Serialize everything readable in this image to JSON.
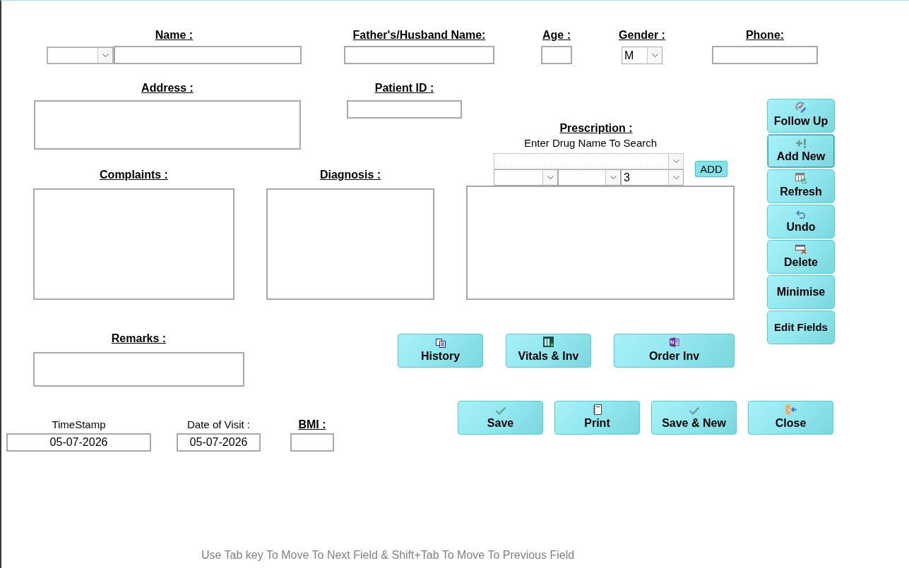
{
  "header_fields": [
    {
      "kind": "titled",
      "label": "Name :"
    },
    {
      "kind": "text",
      "label": "Father's/Husband Name:"
    },
    {
      "kind": "text",
      "label": "Age :"
    },
    {
      "kind": "dropdown",
      "label": "Gender :",
      "value": "M"
    },
    {
      "kind": "text",
      "label": "Phone:"
    }
  ],
  "detail_fields": [
    {
      "kind": "area",
      "label": "Address :"
    },
    {
      "kind": "text",
      "label": "Patient ID :"
    }
  ],
  "note_fields": [
    {
      "label": "Complaints :"
    },
    {
      "label": "Diagnosis :"
    }
  ],
  "prescription": {
    "title": "Prescription :",
    "search_label": "Enter Drug Name To Search",
    "add_button": "ADD",
    "dropdown_3_value": "3"
  },
  "side_buttons": [
    {
      "kind": "followup",
      "label": "Follow Up",
      "focused": false
    },
    {
      "kind": "add",
      "label": "Add New",
      "focused": true
    },
    {
      "kind": "refresh",
      "label": "Refresh",
      "focused": false
    },
    {
      "kind": "undo",
      "label": "Undo",
      "focused": false
    },
    {
      "kind": "delete",
      "label": "Delete",
      "focused": false
    },
    {
      "kind": "plain",
      "label": "Minimise",
      "focused": false
    },
    {
      "kind": "plain",
      "label": "Edit Fields",
      "focused": false
    }
  ],
  "remarks": {
    "label": "Remarks :"
  },
  "action_buttons": [
    {
      "kind": "documents",
      "label": "History"
    },
    {
      "kind": "grid",
      "label": "Vitals & Inv"
    },
    {
      "kind": "notebook",
      "label": "Order Inv"
    }
  ],
  "visit_fields": [
    {
      "kind": "plain",
      "label": "TimeStamp",
      "value": "05-07-2026"
    },
    {
      "kind": "plain",
      "label": "Date of Visit :",
      "value": "05-07-2026"
    },
    {
      "kind": "heading",
      "label": "BMI :"
    }
  ],
  "bottom_buttons": [
    {
      "kind": "check",
      "label": "Save"
    },
    {
      "kind": "page",
      "label": "Print"
    },
    {
      "kind": "check",
      "label": "Save & New"
    },
    {
      "kind": "exit",
      "label": "Close"
    }
  ],
  "footer_hint": "Use Tab key To Move To Next Field & Shift+Tab To Move To Previous Field"
}
